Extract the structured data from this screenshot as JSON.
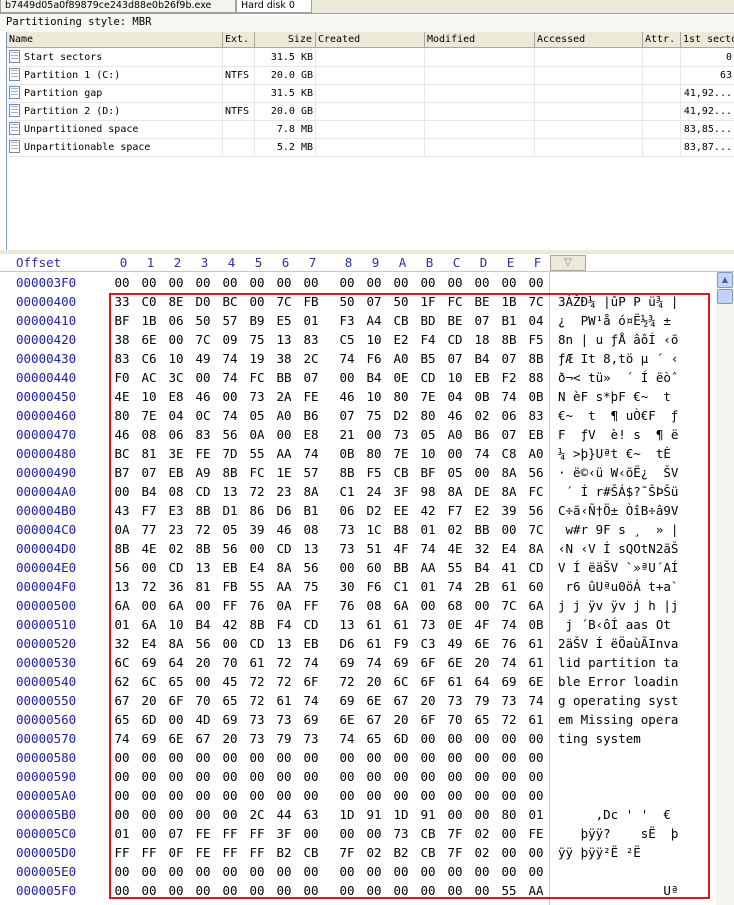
{
  "tabs": [
    "b7449d05a0f89879ce243d88e0b26f9b.exe",
    "Hard disk 0"
  ],
  "partitioning_style": "Partitioning style: MBR",
  "partition_columns": [
    "Name",
    "Ext.",
    "Size",
    "Created",
    "Modified",
    "Accessed",
    "Attr.",
    "1st secto"
  ],
  "partitions": [
    {
      "name": "Start sectors",
      "ext": "",
      "size": "31.5 KB",
      "first": "0"
    },
    {
      "name": "Partition 1 (C:)",
      "ext": "NTFS",
      "size": "20.0 GB",
      "first": "63"
    },
    {
      "name": "Partition gap",
      "ext": "",
      "size": "31.5 KB",
      "first": "41,92..."
    },
    {
      "name": "Partition 2 (D:)",
      "ext": "NTFS",
      "size": "20.0 GB",
      "first": "41,92..."
    },
    {
      "name": "Unpartitioned space",
      "ext": "",
      "size": "7.8 MB",
      "first": "83,85..."
    },
    {
      "name": "Unpartitionable space",
      "ext": "",
      "size": "5.2 MB",
      "first": "83,87..."
    }
  ],
  "hex_header": {
    "offset_label": "Offset",
    "columns": [
      "0",
      "1",
      "2",
      "3",
      "4",
      "5",
      "6",
      "7",
      "8",
      "9",
      "A",
      "B",
      "C",
      "D",
      "E",
      "F"
    ]
  },
  "hex_rows": [
    {
      "offset": "000003F0",
      "bytes": "00 00 00 00 00 00 00 00 00 00 00 00 00 00 00 00",
      "ascii": ""
    },
    {
      "offset": "00000400",
      "bytes": "33 C0 8E D0 BC 00 7C FB 50 07 50 1F FC BE 1B 7C",
      "ascii": "3ÀŽÐ¼ |ûP P ü¾ |"
    },
    {
      "offset": "00000410",
      "bytes": "BF 1B 06 50 57 B9 E5 01 F3 A4 CB BD BE 07 B1 04",
      "ascii": "¿  PW¹å ó¤Ë½¾ ±"
    },
    {
      "offset": "00000420",
      "bytes": "38 6E 00 7C 09 75 13 83 C5 10 E2 F4 CD 18 8B F5",
      "ascii": "8n | u ƒÅ âôÍ ‹õ"
    },
    {
      "offset": "00000430",
      "bytes": "83 C6 10 49 74 19 38 2C 74 F6 A0 B5 07 B4 07 8B",
      "ascii": "ƒÆ It 8,tö µ ´ ‹"
    },
    {
      "offset": "00000440",
      "bytes": "F0 AC 3C 00 74 FC BB 07 00 B4 0E CD 10 EB F2 88",
      "ascii": "ð¬< tü»  ´ Í ëòˆ"
    },
    {
      "offset": "00000450",
      "bytes": "4E 10 E8 46 00 73 2A FE 46 10 80 7E 04 0B 74 0B",
      "ascii": "N èF s*þF €~  t"
    },
    {
      "offset": "00000460",
      "bytes": "80 7E 04 0C 74 05 A0 B6 07 75 D2 80 46 02 06 83",
      "ascii": "€~  t  ¶ uÒ€F  ƒ"
    },
    {
      "offset": "00000470",
      "bytes": "46 08 06 83 56 0A 00 E8 21 00 73 05 A0 B6 07 EB",
      "ascii": "F  ƒV  è! s  ¶ ë"
    },
    {
      "offset": "00000480",
      "bytes": "BC 81 3E FE 7D 55 AA 74 0B 80 7E 10 00 74 C8 A0",
      "ascii": "¼ >þ}Uªt €~  tÈ "
    },
    {
      "offset": "00000490",
      "bytes": "B7 07 EB A9 8B FC 1E 57 8B F5 CB BF 05 00 8A 56",
      "ascii": "· ë©‹ü W‹õË¿  ŠV"
    },
    {
      "offset": "000004A0",
      "bytes": "00 B4 08 CD 13 72 23 8A C1 24 3F 98 8A DE 8A FC",
      "ascii": " ´ Í r#ŠÁ$?˜ŠÞŠü"
    },
    {
      "offset": "000004B0",
      "bytes": "43 F7 E3 8B D1 86 D6 B1 06 D2 EE 42 F7 E2 39 56",
      "ascii": "C÷ã‹Ñ†Ö± ÒîB÷â9V"
    },
    {
      "offset": "000004C0",
      "bytes": "0A 77 23 72 05 39 46 08 73 1C B8 01 02 BB 00 7C",
      "ascii": " w#r 9F s ¸  » |"
    },
    {
      "offset": "000004D0",
      "bytes": "8B 4E 02 8B 56 00 CD 13 73 51 4F 74 4E 32 E4 8A",
      "ascii": "‹N ‹V Í sQOtN2äŠ"
    },
    {
      "offset": "000004E0",
      "bytes": "56 00 CD 13 EB E4 8A 56 00 60 BB AA 55 B4 41 CD",
      "ascii": "V Í ëäŠV `»ªU´AÍ"
    },
    {
      "offset": "000004F0",
      "bytes": "13 72 36 81 FB 55 AA 75 30 F6 C1 01 74 2B 61 60",
      "ascii": " r6 ûUªu0öÁ t+a`"
    },
    {
      "offset": "00000500",
      "bytes": "6A 00 6A 00 FF 76 0A FF 76 08 6A 00 68 00 7C 6A",
      "ascii": "j j ÿv ÿv j h |j"
    },
    {
      "offset": "00000510",
      "bytes": "01 6A 10 B4 42 8B F4 CD 13 61 61 73 0E 4F 74 0B",
      "ascii": " j ´B‹ôÍ aas Ot"
    },
    {
      "offset": "00000520",
      "bytes": "32 E4 8A 56 00 CD 13 EB D6 61 F9 C3 49 6E 76 61",
      "ascii": "2äŠV Í ëÖaùÃInva"
    },
    {
      "offset": "00000530",
      "bytes": "6C 69 64 20 70 61 72 74 69 74 69 6F 6E 20 74 61",
      "ascii": "lid partition ta"
    },
    {
      "offset": "00000540",
      "bytes": "62 6C 65 00 45 72 72 6F 72 20 6C 6F 61 64 69 6E",
      "ascii": "ble Error loadin"
    },
    {
      "offset": "00000550",
      "bytes": "67 20 6F 70 65 72 61 74 69 6E 67 20 73 79 73 74",
      "ascii": "g operating syst"
    },
    {
      "offset": "00000560",
      "bytes": "65 6D 00 4D 69 73 73 69 6E 67 20 6F 70 65 72 61",
      "ascii": "em Missing opera"
    },
    {
      "offset": "00000570",
      "bytes": "74 69 6E 67 20 73 79 73 74 65 6D 00 00 00 00 00",
      "ascii": "ting system"
    },
    {
      "offset": "00000580",
      "bytes": "00 00 00 00 00 00 00 00 00 00 00 00 00 00 00 00",
      "ascii": ""
    },
    {
      "offset": "00000590",
      "bytes": "00 00 00 00 00 00 00 00 00 00 00 00 00 00 00 00",
      "ascii": ""
    },
    {
      "offset": "000005A0",
      "bytes": "00 00 00 00 00 00 00 00 00 00 00 00 00 00 00 00",
      "ascii": ""
    },
    {
      "offset": "000005B0",
      "bytes": "00 00 00 00 00 2C 44 63 1D 91 1D 91 00 00 80 01",
      "ascii": "     ,Dc ' '  €"
    },
    {
      "offset": "000005C0",
      "bytes": "01 00 07 FE FF FF 3F 00 00 00 73 CB 7F 02 00 FE",
      "ascii": "   þÿÿ?    sË  þ"
    },
    {
      "offset": "000005D0",
      "bytes": "FF FF 0F FE FF FF B2 CB 7F 02 B2 CB 7F 02 00 00",
      "ascii": "ÿÿ þÿÿ²Ë ²Ë"
    },
    {
      "offset": "000005E0",
      "bytes": "00 00 00 00 00 00 00 00 00 00 00 00 00 00 00 00",
      "ascii": ""
    },
    {
      "offset": "000005F0",
      "bytes": "00 00 00 00 00 00 00 00 00 00 00 00 00 00 55 AA",
      "ascii": "              Uª"
    }
  ]
}
